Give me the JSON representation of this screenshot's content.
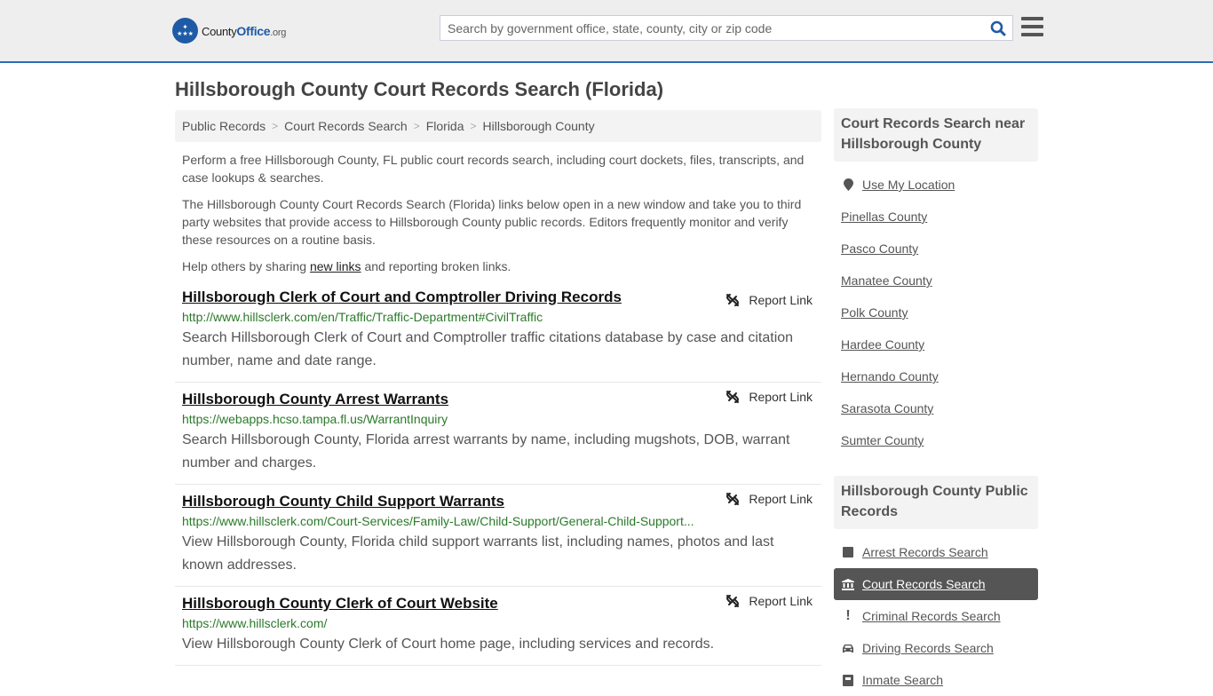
{
  "header": {
    "logo": {
      "part1": "County",
      "part2": "Office",
      "part3": ".org"
    },
    "search_placeholder": "Search by government office, state, county, city or zip code",
    "search_value": ""
  },
  "page_title": "Hillsborough County Court Records Search (Florida)",
  "breadcrumb": [
    "Public Records",
    "Court Records Search",
    "Florida",
    "Hillsborough County"
  ],
  "intro": {
    "p1": "Perform a free Hillsborough County, FL public court records search, including court dockets, files, transcripts, and case lookups & searches.",
    "p2": "The Hillsborough County Court Records Search (Florida) links below open in a new window and take you to third party websites that provide access to Hillsborough County public records. Editors frequently monitor and verify these resources on a routine basis.",
    "p3_before": "Help others by sharing ",
    "p3_link": "new links",
    "p3_after": " and reporting broken links."
  },
  "report_label": "Report Link",
  "links": [
    {
      "title": "Hillsborough Clerk of Court and Comptroller Driving Records",
      "url": "http://www.hillsclerk.com/en/Traffic/Traffic-Department#CivilTraffic",
      "desc": "Search Hillsborough Clerk of Court and Comptroller traffic citations database by case and citation number, name and date range."
    },
    {
      "title": "Hillsborough County Arrest Warrants",
      "url": "https://webapps.hcso.tampa.fl.us/WarrantInquiry",
      "desc": "Search Hillsborough County, Florida arrest warrants by name, including mugshots, DOB, warrant number and charges."
    },
    {
      "title": "Hillsborough County Child Support Warrants",
      "url": "https://www.hillsclerk.com/Court-Services/Family-Law/Child-Support/General-Child-Support...",
      "desc": "View Hillsborough County, Florida child support warrants list, including names, photos and last known addresses."
    },
    {
      "title": "Hillsborough County Clerk of Court Website",
      "url": "https://www.hillsclerk.com/",
      "desc": "View Hillsborough County Clerk of Court home page, including services and records."
    }
  ],
  "sidebar": {
    "nearby_title": "Court Records Search near Hillsborough County",
    "use_location": "Use My Location",
    "nearby": [
      "Pinellas County",
      "Pasco County",
      "Manatee County",
      "Polk County",
      "Hardee County",
      "Hernando County",
      "Sarasota County",
      "Sumter County"
    ],
    "public_title": "Hillsborough County Public Records",
    "public_records": [
      {
        "label": "Arrest Records Search",
        "icon": "square-icon",
        "glyph": "■",
        "active": false
      },
      {
        "label": "Court Records Search",
        "icon": "courthouse-icon",
        "glyph": "🏛",
        "active": true
      },
      {
        "label": "Criminal Records Search",
        "icon": "exclamation-icon",
        "glyph": "!",
        "active": false
      },
      {
        "label": "Driving Records Search",
        "icon": "car-icon",
        "glyph": "🚘",
        "active": false
      },
      {
        "label": "Inmate Search",
        "icon": "inmate-icon",
        "glyph": "■",
        "active": false
      }
    ]
  }
}
